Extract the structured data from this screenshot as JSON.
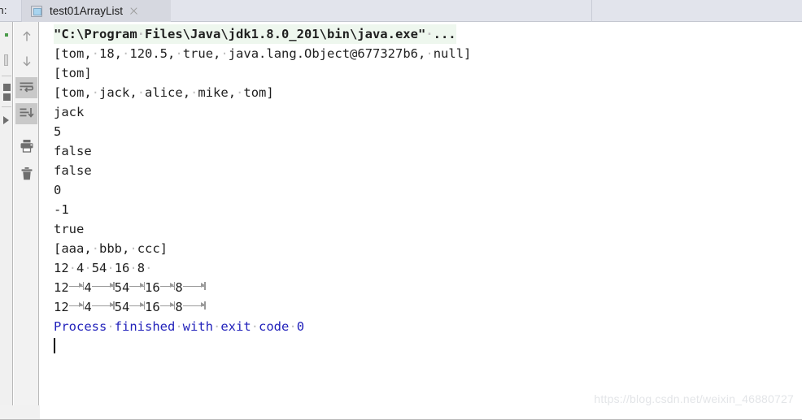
{
  "window": {
    "tool_label": "un:",
    "tool_label_full": "Run:"
  },
  "tab": {
    "title": "test01ArrayList",
    "icon": "run-configuration-icon",
    "close_icon": "close-icon"
  },
  "gutter": {
    "buttons": [
      {
        "name": "up-arrow-icon",
        "label": "Up the stack trace",
        "active": false
      },
      {
        "name": "down-arrow-icon",
        "label": "Down the stack trace",
        "active": false
      },
      {
        "name": "soft-wrap-icon",
        "label": "Soft-Wrap",
        "active": true
      },
      {
        "name": "scroll-to-end-icon",
        "label": "Scroll to the end",
        "active": true
      },
      {
        "name": "print-icon",
        "label": "Print",
        "active": false
      },
      {
        "name": "trash-icon",
        "label": "Clear All",
        "active": false
      }
    ]
  },
  "left_strip": {
    "name": "debug-toolbar-strip",
    "visible": true
  },
  "console": {
    "lines": [
      {
        "type": "command",
        "text": "\"C:\\Program Files\\Java\\jdk1.8.0_201\\bin\\java.exe\" ..."
      },
      {
        "type": "output",
        "text": "[tom, 18, 120.5, true, java.lang.Object@677327b6, null]"
      },
      {
        "type": "output",
        "text": "[tom]"
      },
      {
        "type": "output",
        "text": "[tom, jack, alice, mike, tom]"
      },
      {
        "type": "output",
        "text": "jack"
      },
      {
        "type": "output",
        "text": "5"
      },
      {
        "type": "output",
        "text": "false"
      },
      {
        "type": "output",
        "text": "false"
      },
      {
        "type": "output",
        "text": "0"
      },
      {
        "type": "output",
        "text": "-1"
      },
      {
        "type": "output",
        "text": "true"
      },
      {
        "type": "output",
        "text": "[aaa, bbb, ccc]"
      },
      {
        "type": "output",
        "text": "12 4 54 16 8 "
      },
      {
        "type": "output-tabs",
        "text": "12\t4\t54\t16\t8\t"
      },
      {
        "type": "output-tabs",
        "text": "12\t4\t54\t16\t8\t"
      },
      {
        "type": "info",
        "text": "Process finished with exit code 0"
      },
      {
        "type": "caret",
        "text": ""
      }
    ]
  },
  "watermark": {
    "text": "https://blog.csdn.net/weixin_46880727"
  },
  "colors": {
    "tabbar_bg": "#e2e4ec",
    "tab_active_bg": "#d6d8e0",
    "console_bg": "#ffffff",
    "command_highlight": "#eef7ee",
    "output_text": "#1f1f1f",
    "info_text": "#2222bb",
    "whitespace_marker": "#c0c0c0",
    "watermark": "#e3e5e8"
  }
}
